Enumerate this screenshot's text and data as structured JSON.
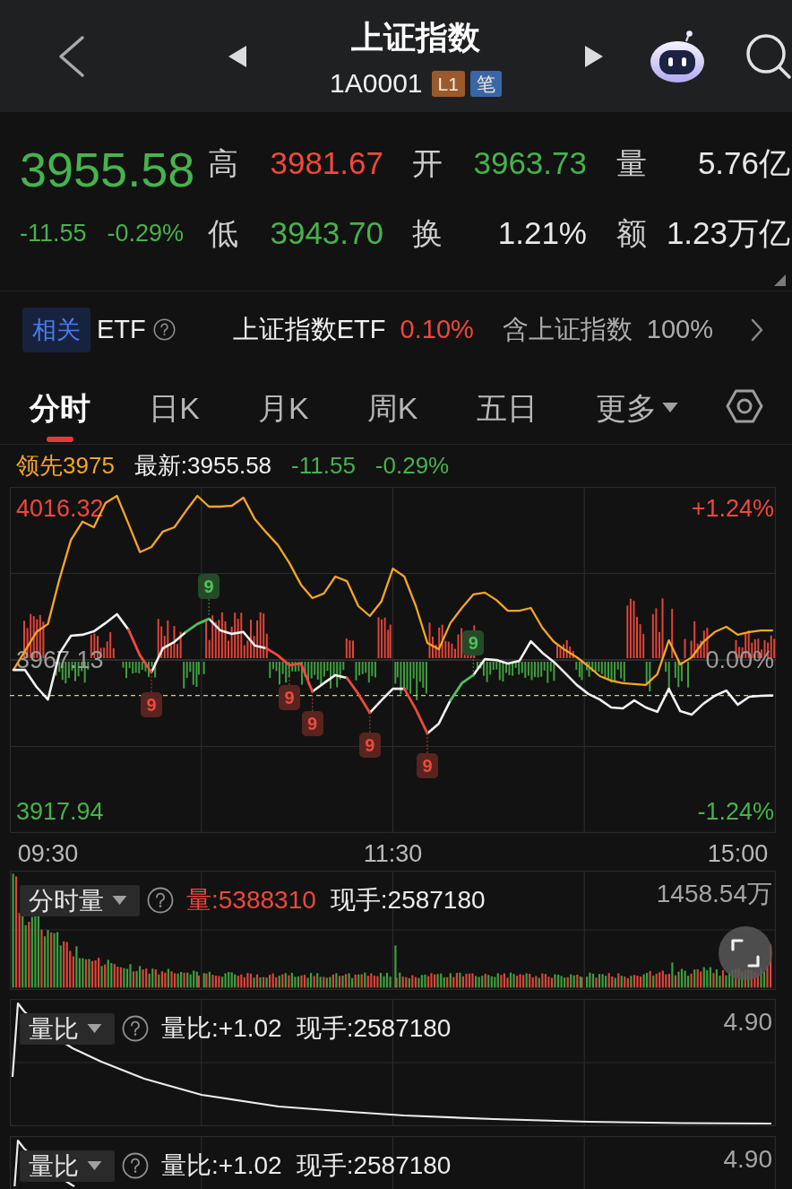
{
  "header": {
    "title": "上证指数",
    "code": "1A0001",
    "badges": [
      {
        "text": "L1",
        "color": "#9a5a2b"
      },
      {
        "text": "笔",
        "color": "#3b66a5"
      }
    ]
  },
  "quote": {
    "price": "3955.58",
    "change": "-11.55",
    "change_pct": "-0.29%",
    "falling": true,
    "stats": [
      {
        "label": "高",
        "value": "3981.67",
        "color": "#f0483c"
      },
      {
        "label": "开",
        "value": "3963.73",
        "color": "#46b34c"
      },
      {
        "label": "量",
        "value": "5.76亿",
        "color": "#e8e8e8"
      },
      {
        "label": "低",
        "value": "3943.70",
        "color": "#46b34c"
      },
      {
        "label": "换",
        "value": "1.21%",
        "color": "#e8e8e8"
      },
      {
        "label": "额",
        "value": "1.23万亿",
        "color": "#e8e8e8"
      }
    ]
  },
  "related_etf": {
    "tag": "相关",
    "label": "ETF",
    "fund": "上证指数ETF",
    "fund_change": "0.10%",
    "fund_falling": false,
    "holding": "含上证指数",
    "holding_pct": "100%"
  },
  "tabs": [
    {
      "label": "分时",
      "kind": "tab",
      "selected": true
    },
    {
      "label": "日K",
      "kind": "tab",
      "selected": false
    },
    {
      "label": "月K",
      "kind": "tab",
      "selected": false
    },
    {
      "label": "周K",
      "kind": "tab",
      "selected": false
    },
    {
      "label": "五日",
      "kind": "tab",
      "selected": false
    },
    {
      "label": "更多",
      "kind": "menu",
      "selected": false
    }
  ],
  "legend": {
    "lead": "领先3975",
    "latest": "最新:3955.58",
    "change": "-11.55",
    "change_pct": "-0.29%",
    "falling": true
  },
  "intraday_chart": {
    "chart_data": {
      "type": "line",
      "categories": [
        null,
        null,
        null,
        "09:30",
        null,
        null,
        null,
        null,
        null,
        null,
        null,
        null,
        null,
        null,
        null,
        null,
        null,
        null,
        null,
        null,
        null,
        null,
        null,
        null,
        null,
        null,
        null,
        null,
        null,
        null,
        null,
        null,
        null,
        "11:30",
        null,
        null,
        null,
        null,
        null,
        null,
        null,
        null,
        null,
        null,
        null,
        null,
        null,
        null,
        null,
        null,
        null,
        null,
        null,
        null,
        null,
        null,
        null,
        null,
        null,
        null,
        null,
        null,
        null,
        "15:00",
        null,
        null,
        null
      ],
      "ylim": [
        3910.96,
        4023.3
      ],
      "yticks": [
        {
          "value": 4016.32,
          "label": "4016.32"
        },
        {
          "value": 3967.13,
          "label": "3967.13"
        },
        {
          "value": 3917.94,
          "label": "3917.94"
        }
      ],
      "y2lim": [
        -1.416,
        1.416
      ],
      "y2ticks": [
        {
          "value": 1.24,
          "label": "+1.24%"
        },
        {
          "value": 0,
          "label": "0.00%"
        },
        {
          "value": -1.24,
          "label": "-1.24%"
        }
      ],
      "series": [
        {
          "color": "#f2f2f2",
          "values": [
            3963.9,
            3963.9,
            3958.4,
            3954.3,
            3969.2,
            3975.0,
            3975.3,
            3976.4,
            3979.1,
            3982.0,
            3977.0,
            null,
            3963.1,
            3970.9,
            3973.0,
            3976.2,
            null,
            3980.5,
            3976.7,
            3975.6,
            3976.2,
            3971.8,
            3970.9,
            null,
            null,
            null,
            3956.9,
            3959.6,
            3962.2,
            3961.3,
            null,
            3950.0,
            3954.0,
            3957.8,
            3957.8,
            null,
            3943.3,
            3946.5,
            3954.0,
            null,
            3962.2,
            3967.4,
            3967.1,
            3966.0,
            3966.8,
            3973.2,
            3969.5,
            3966.5,
            3962.8,
            3959.0,
            3956.1,
            3954.3,
            3951.7,
            3951.4,
            3954.0,
            3951.7,
            3950.3,
            3957.8,
            3950.5,
            3949.4,
            3952.9,
            3955.5,
            3957.2,
            3952.6,
            3955.2,
            3955.5,
            3955.6
          ]
        },
        {
          "color": "#f5a623",
          "values": [
            3963.9,
            3970.0,
            3976.2,
            3978.8,
            3993.3,
            4006.1,
            4012.0,
            4010.2,
            4018.1,
            4020.4,
            4011.4,
            4002.1,
            4003.8,
            4008.8,
            4010.2,
            4015.5,
            4020.4,
            4016.9,
            4016.9,
            4017.2,
            4019.8,
            4012.8,
            4008.5,
            4004.4,
            3998.6,
            3991.6,
            3987.2,
            3988.7,
            3994.2,
            3992.7,
            3984.6,
            3981.4,
            3986.1,
            3996.8,
            3994.2,
            3984.6,
            3972.7,
            3970.6,
            3979.1,
            3984.0,
            3988.4,
            3989.0,
            3986.6,
            3983.1,
            3983.1,
            3984.0,
            3977.6,
            3973.0,
            3970.3,
            3968.0,
            3965.1,
            3961.9,
            3960.4,
            3959.6,
            3959.3,
            3959.0,
            3962.5,
            3973.5,
            3965.7,
            3968.0,
            3973.0,
            3976.2,
            3977.9,
            3975.3,
            3976.2,
            3976.7,
            3976.7
          ]
        },
        {
          "color": "#ee4a3d",
          "values": [
            null,
            null,
            null,
            null,
            null,
            null,
            null,
            null,
            null,
            null,
            3977.0,
            3968.6,
            3963.1,
            null,
            null,
            null,
            null,
            null,
            null,
            null,
            null,
            null,
            3970.9,
            3968.6,
            3965.4,
            3966.0,
            3956.9,
            null,
            null,
            3961.3,
            3956.1,
            3950.0,
            null,
            null,
            3957.8,
            3951.1,
            3943.3,
            null,
            null,
            null,
            null,
            null,
            null,
            null,
            null,
            null,
            null,
            null,
            null,
            null,
            null,
            null,
            null,
            null,
            null,
            null,
            null,
            null,
            null,
            null,
            null,
            null,
            null,
            null,
            null,
            null,
            null
          ]
        },
        {
          "color": "#4fc159",
          "values": [
            null,
            null,
            null,
            null,
            null,
            null,
            null,
            null,
            null,
            null,
            null,
            null,
            null,
            null,
            null,
            3976.2,
            3978.8,
            3980.5,
            null,
            null,
            null,
            null,
            null,
            null,
            null,
            null,
            null,
            null,
            null,
            null,
            null,
            null,
            null,
            null,
            null,
            null,
            null,
            null,
            3954.0,
            3959.6,
            3962.2,
            null,
            null,
            null,
            null,
            null,
            null,
            null,
            null,
            null,
            null,
            null,
            null,
            null,
            null,
            null,
            null,
            null,
            null,
            null,
            null,
            null,
            null,
            null,
            null,
            null,
            null
          ]
        }
      ],
      "annotations": [
        "9",
        "9",
        "9",
        "9",
        "9",
        "9",
        "9"
      ]
    }
  },
  "volume_panel": {
    "selector": "分时量",
    "volume": "量:5388310",
    "hand": "现手:2587180",
    "max": "1458.54万"
  },
  "ratio_panels": [
    {
      "selector": "量比",
      "ratio": "量比:+1.02",
      "hand": "现手:2587180",
      "max": "4.90"
    },
    {
      "selector": "量比",
      "ratio": "量比:+1.02",
      "hand": "现手:2587180",
      "max": "4.90"
    }
  ]
}
